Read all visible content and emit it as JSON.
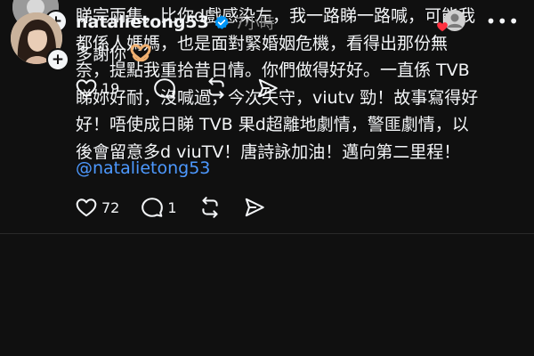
{
  "post": {
    "text": "睇完兩集，比你d戲感染左，我一路睇一路喊，可能我\n都係人媽媽，也是面對緊婚姻危機，看得出那份無\n奈，提點我重拾昔日情。你們做得好好。一直係 TVB\n睇妳好耐，沒喊過，今次失守，viutv 勁！故事寫得好\n好！唔使成日睇 TVB 果d超離地劇情，警匪劇情，以\n後會留意多d viuTV！唐詩詠加油！邁向第二里程！",
    "mention": "@natalietong53",
    "actions": {
      "like_count": "72",
      "comment_count": "1"
    },
    "icons": [
      "heart-icon",
      "comment-icon",
      "repost-icon",
      "share-icon",
      "follow-plus-icon"
    ]
  },
  "reply": {
    "username": "natalietong53",
    "time": "7小時",
    "text": "多謝你",
    "emoji_name": "heart-hands-icon",
    "actions": {
      "like_count": "19"
    },
    "icons": [
      "verified-icon",
      "liked-by-author-icon",
      "more-icon",
      "heart-icon",
      "comment-icon",
      "repost-icon",
      "share-icon"
    ]
  },
  "colors": {
    "background": "#101010",
    "text": "#f3f5f7",
    "link": "#4d99ff",
    "muted": "#8a8a8a",
    "verified": "#0095f6",
    "like_red": "#ff3040"
  }
}
